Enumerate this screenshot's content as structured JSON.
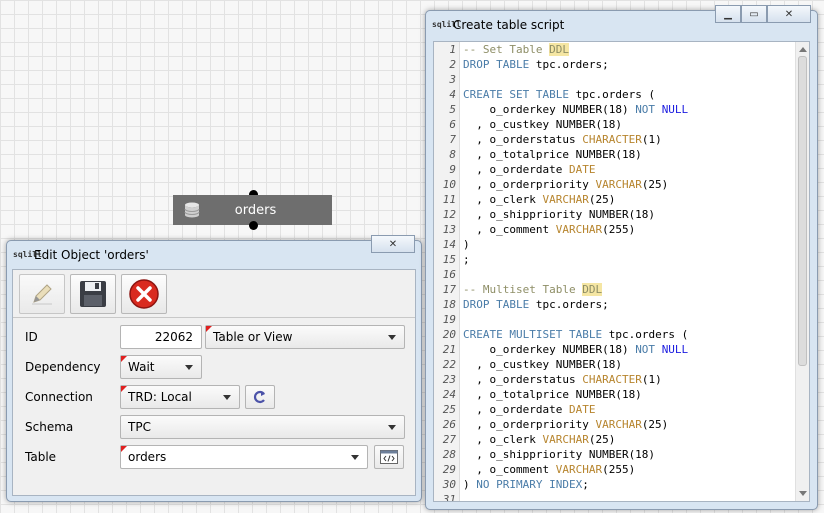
{
  "canvas": {
    "node": {
      "label": "orders",
      "icon": "database-icon"
    }
  },
  "edit_window": {
    "title": "Edit Object 'orders'",
    "toolbar": {
      "edit_icon": "pencil-icon",
      "save_icon": "floppy-disk-icon",
      "cancel_icon": "red-x-icon"
    },
    "form": {
      "id": {
        "label": "ID",
        "value": "22062",
        "type_value": "Table or View"
      },
      "dependency": {
        "label": "Dependency",
        "value": "Wait"
      },
      "connection": {
        "label": "Connection",
        "value": "TRD: Local"
      },
      "schema": {
        "label": "Schema",
        "value": "TPC"
      },
      "table": {
        "label": "Table",
        "value": "orders"
      }
    }
  },
  "script_window": {
    "title": "Create table script",
    "lines": [
      "-- Set Table DDL",
      "DROP TABLE tpc.orders;",
      "",
      "CREATE SET TABLE tpc.orders (",
      "    o_orderkey NUMBER(18) NOT NULL",
      "  , o_custkey NUMBER(18)",
      "  , o_orderstatus CHARACTER(1)",
      "  , o_totalprice NUMBER(18)",
      "  , o_orderdate DATE",
      "  , o_orderpriority VARCHAR(25)",
      "  , o_clerk VARCHAR(25)",
      "  , o_shippriority NUMBER(18)",
      "  , o_comment VARCHAR(255)",
      ")",
      ";",
      "",
      "-- Multiset Table DDL",
      "DROP TABLE tpc.orders;",
      "",
      "CREATE MULTISET TABLE tpc.orders (",
      "    o_orderkey NUMBER(18) NOT NULL",
      "  , o_custkey NUMBER(18)",
      "  , o_orderstatus CHARACTER(1)",
      "  , o_totalprice NUMBER(18)",
      "  , o_orderdate DATE",
      "  , o_orderpriority VARCHAR(25)",
      "  , o_clerk VARCHAR(25)",
      "  , o_shippriority NUMBER(18)",
      "  , o_comment VARCHAR(255)",
      ") NO PRIMARY INDEX;",
      ""
    ]
  },
  "app_logo": "sqlill"
}
